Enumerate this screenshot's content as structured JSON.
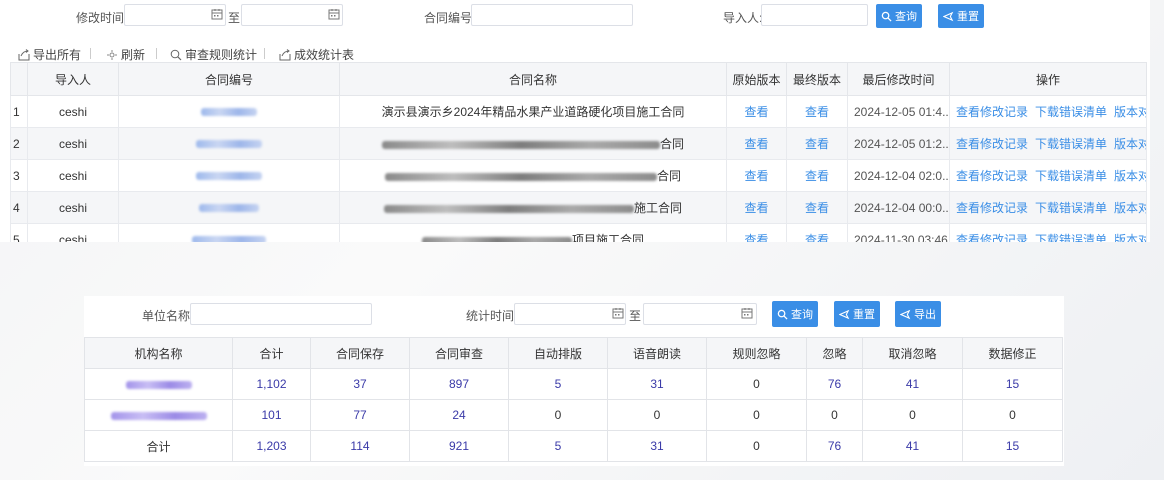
{
  "top": {
    "search": {
      "modify_time_label": "修改时间:",
      "date_separator": "至",
      "contract_no_label": "合同编号:",
      "importer_label": "导入人:",
      "query_button": "查询",
      "reset_button": "重置"
    },
    "toolbar": {
      "export_all": "导出所有",
      "refresh": "刷新",
      "rule_stats": "审查规则统计",
      "effect_stats": "成效统计表"
    },
    "table": {
      "headers": [
        "",
        "导入人",
        "合同编号",
        "合同名称",
        "原始版本",
        "最终版本",
        "最后修改时间",
        "操作"
      ],
      "rows": [
        {
          "index": "1",
          "importer": "ceshi",
          "name_suffix": "演示县演示乡2024年精品水果产业道路硬化项目施工合同",
          "original": "查看",
          "final": "查看",
          "time": "2024-12-05 01:4...",
          "op1": "查看修改记录",
          "op2": "下载错误清单",
          "op3": "版本对照"
        },
        {
          "index": "2",
          "importer": "ceshi",
          "name_suffix": "合同",
          "original": "查看",
          "final": "查看",
          "time": "2024-12-05 01:2...",
          "op1": "查看修改记录",
          "op2": "下载错误清单",
          "op3": "版本对照"
        },
        {
          "index": "3",
          "importer": "ceshi",
          "name_suffix": "合同",
          "original": "查看",
          "final": "查看",
          "time": "2024-12-04 02:0...",
          "op1": "查看修改记录",
          "op2": "下载错误清单",
          "op3": "版本对照"
        },
        {
          "index": "4",
          "importer": "ceshi",
          "name_suffix": "施工合同",
          "original": "查看",
          "final": "查看",
          "time": "2024-12-04 00:0...",
          "op1": "查看修改记录",
          "op2": "下载错误清单",
          "op3": "版本对照"
        },
        {
          "index": "5",
          "importer": "ceshi",
          "name_suffix": "项目施工合同",
          "original": "查看",
          "final": "查看",
          "time": "2024-11-30 03:46",
          "op1": "查看修改记录",
          "op2": "下载错误清单",
          "op3": "版本对照"
        }
      ]
    }
  },
  "bottom": {
    "search": {
      "unit_label": "单位名称:",
      "stat_time_label": "统计时间:",
      "date_separator": "至",
      "query_button": "查询",
      "reset_button": "重置",
      "export_button": "导出"
    },
    "table": {
      "headers": [
        "机构名称",
        "合计",
        "合同保存",
        "合同审查",
        "自动排版",
        "语音朗读",
        "规则忽略",
        "忽略",
        "取消忽略",
        "数据修正"
      ],
      "rows": [
        {
          "org": "",
          "total": "1,102",
          "save": "37",
          "review": "897",
          "layout": "5",
          "voice": "31",
          "rule_ignore": "0",
          "ignore": "76",
          "cancel_ignore": "41",
          "fix": "15"
        },
        {
          "org": "",
          "total": "101",
          "save": "77",
          "review": "24",
          "layout": "0",
          "voice": "0",
          "rule_ignore": "0",
          "ignore": "0",
          "cancel_ignore": "0",
          "fix": "0"
        },
        {
          "org": "合计",
          "total": "1,203",
          "save": "114",
          "review": "921",
          "layout": "5",
          "voice": "31",
          "rule_ignore": "0",
          "ignore": "76",
          "cancel_ignore": "41",
          "fix": "15"
        }
      ]
    }
  },
  "colors": {
    "accent": "#3a8ee6",
    "link": "#3a8ee6",
    "number": "#3a3aa8"
  }
}
